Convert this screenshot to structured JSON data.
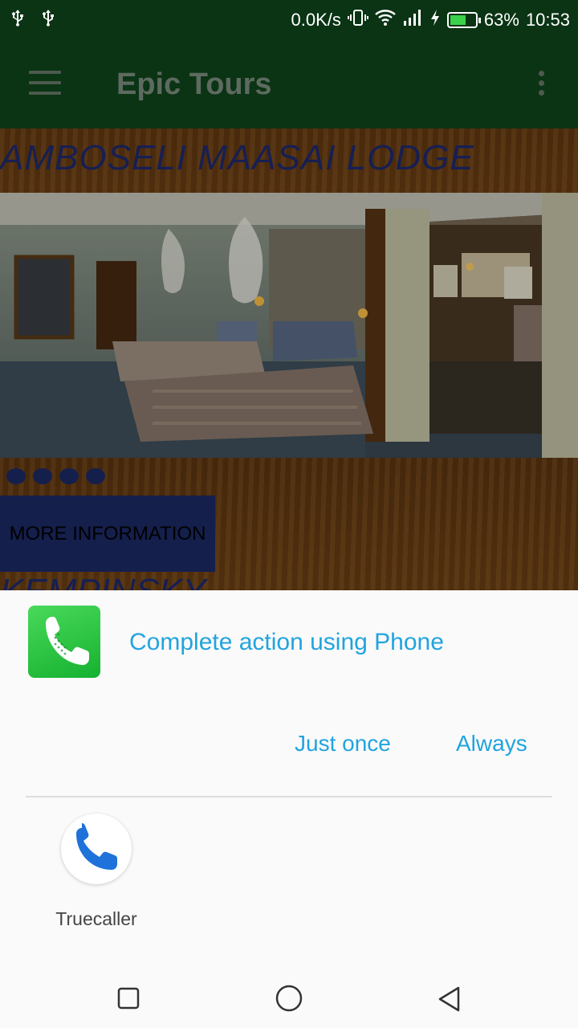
{
  "status_bar": {
    "net_speed": "0.0K/s",
    "battery_percent": "63%",
    "battery_level": 0.63,
    "time": "10:53",
    "icons": [
      "usb-icon",
      "usb-icon",
      "vibrate-icon",
      "wifi-icon",
      "signal-icon",
      "charging-icon",
      "battery-icon"
    ]
  },
  "app_bar": {
    "title": "Epic Tours",
    "menu_icon": "hamburger-menu-icon",
    "overflow_icon": "more-vert-icon"
  },
  "listing": {
    "title": "AMBOSELI MAASAI LODGE",
    "carousel_dots": 4,
    "more_button": "MORE INFORMATION",
    "next_title": "KEMPINSKY"
  },
  "chooser": {
    "title": "Complete action using Phone",
    "just_once": "Just once",
    "always": "Always",
    "apps": [
      {
        "label": "Truecaller",
        "icon": "phone-icon"
      }
    ]
  },
  "nav_bar": {
    "icons": [
      "recents-square-icon",
      "home-circle-icon",
      "back-triangle-icon"
    ]
  },
  "colors": {
    "app_bar": "#0a3414",
    "accent": "#21a4df",
    "listing_title": "#1f2a6e",
    "button_bg": "#1c2a66"
  }
}
